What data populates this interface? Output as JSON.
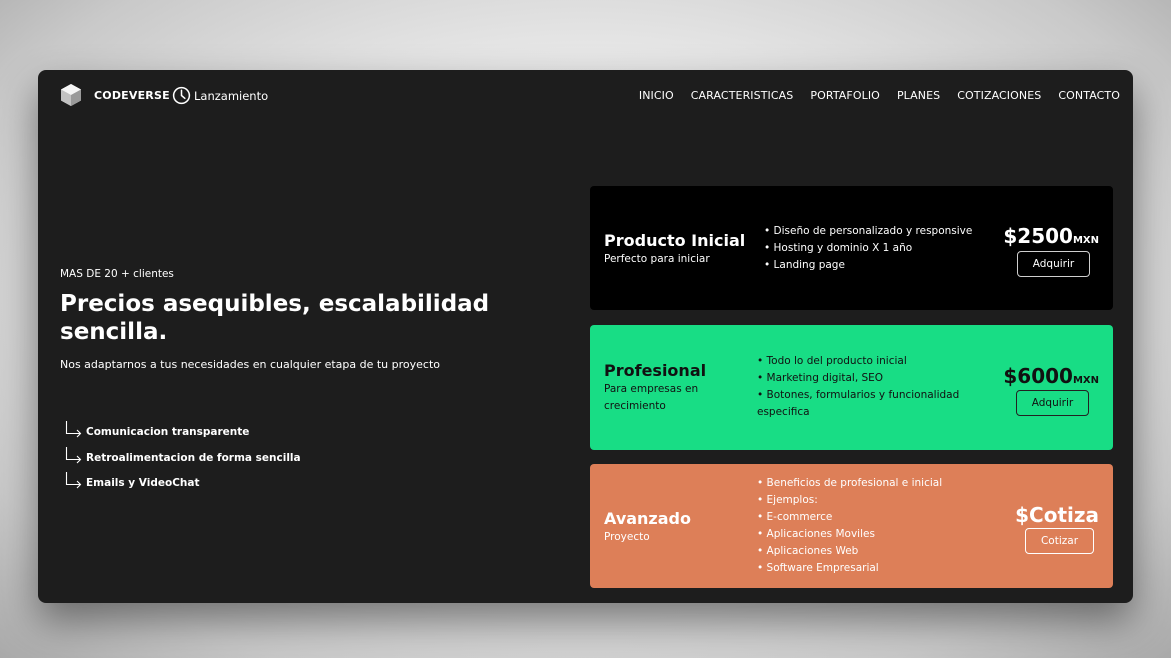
{
  "colors": {
    "window_bg": "#1d1d1d",
    "plan_basic_bg": "#000000",
    "plan_pro_bg": "#18dd85",
    "plan_adv_bg": "#dd7f58",
    "text_light": "#ffffff",
    "text_dark": "#111111"
  },
  "header": {
    "logo_icon": "cube-icon",
    "brand": "CODEVERSE",
    "launch_icon": "clock-icon",
    "launch_label": "Lanzamiento",
    "nav": [
      "INICIO",
      "CARACTERISTICAS",
      "PORTAFOLIO",
      "PLANES",
      "COTIZACIONES",
      "CONTACTO"
    ]
  },
  "hero": {
    "kicker": "MAS DE 20 + clientes",
    "headline": "Precios asequibles, escalabilidad sencilla.",
    "subline": "Nos adaptarnos a tus necesidades en cualquier etapa de tu proyecto",
    "feature_icon": "return-arrow-icon",
    "features": [
      "Comunicacion transparente",
      "Retroalimentacion de forma sencilla",
      "Emails y VideoChat"
    ]
  },
  "plans": [
    {
      "title": "Producto Inicial",
      "subtitle": "Perfecto para iniciar",
      "items": [
        "• Diseño de personalizado y responsive",
        "• Hosting y dominio X 1 año",
        "• Landing page"
      ],
      "price": "$2500",
      "currency": "MXN",
      "button": "Adquirir"
    },
    {
      "title": "Profesional",
      "subtitle": "Para empresas en crecimiento",
      "items": [
        "• Todo lo del producto inicial",
        "• Marketing digital, SEO",
        "• Botones, formularios y funcionalidad especifica"
      ],
      "price": "$6000",
      "currency": "MXN",
      "button": "Adquirir"
    },
    {
      "title": "Avanzado",
      "subtitle": "Proyecto",
      "items": [
        "• Beneficios de profesional e inicial",
        "• Ejemplos:",
        "• E-commerce",
        "• Aplicaciones Moviles",
        "• Aplicaciones Web",
        "• Software Empresarial"
      ],
      "price": "$Cotiza",
      "currency": "",
      "button": "Cotizar"
    }
  ]
}
